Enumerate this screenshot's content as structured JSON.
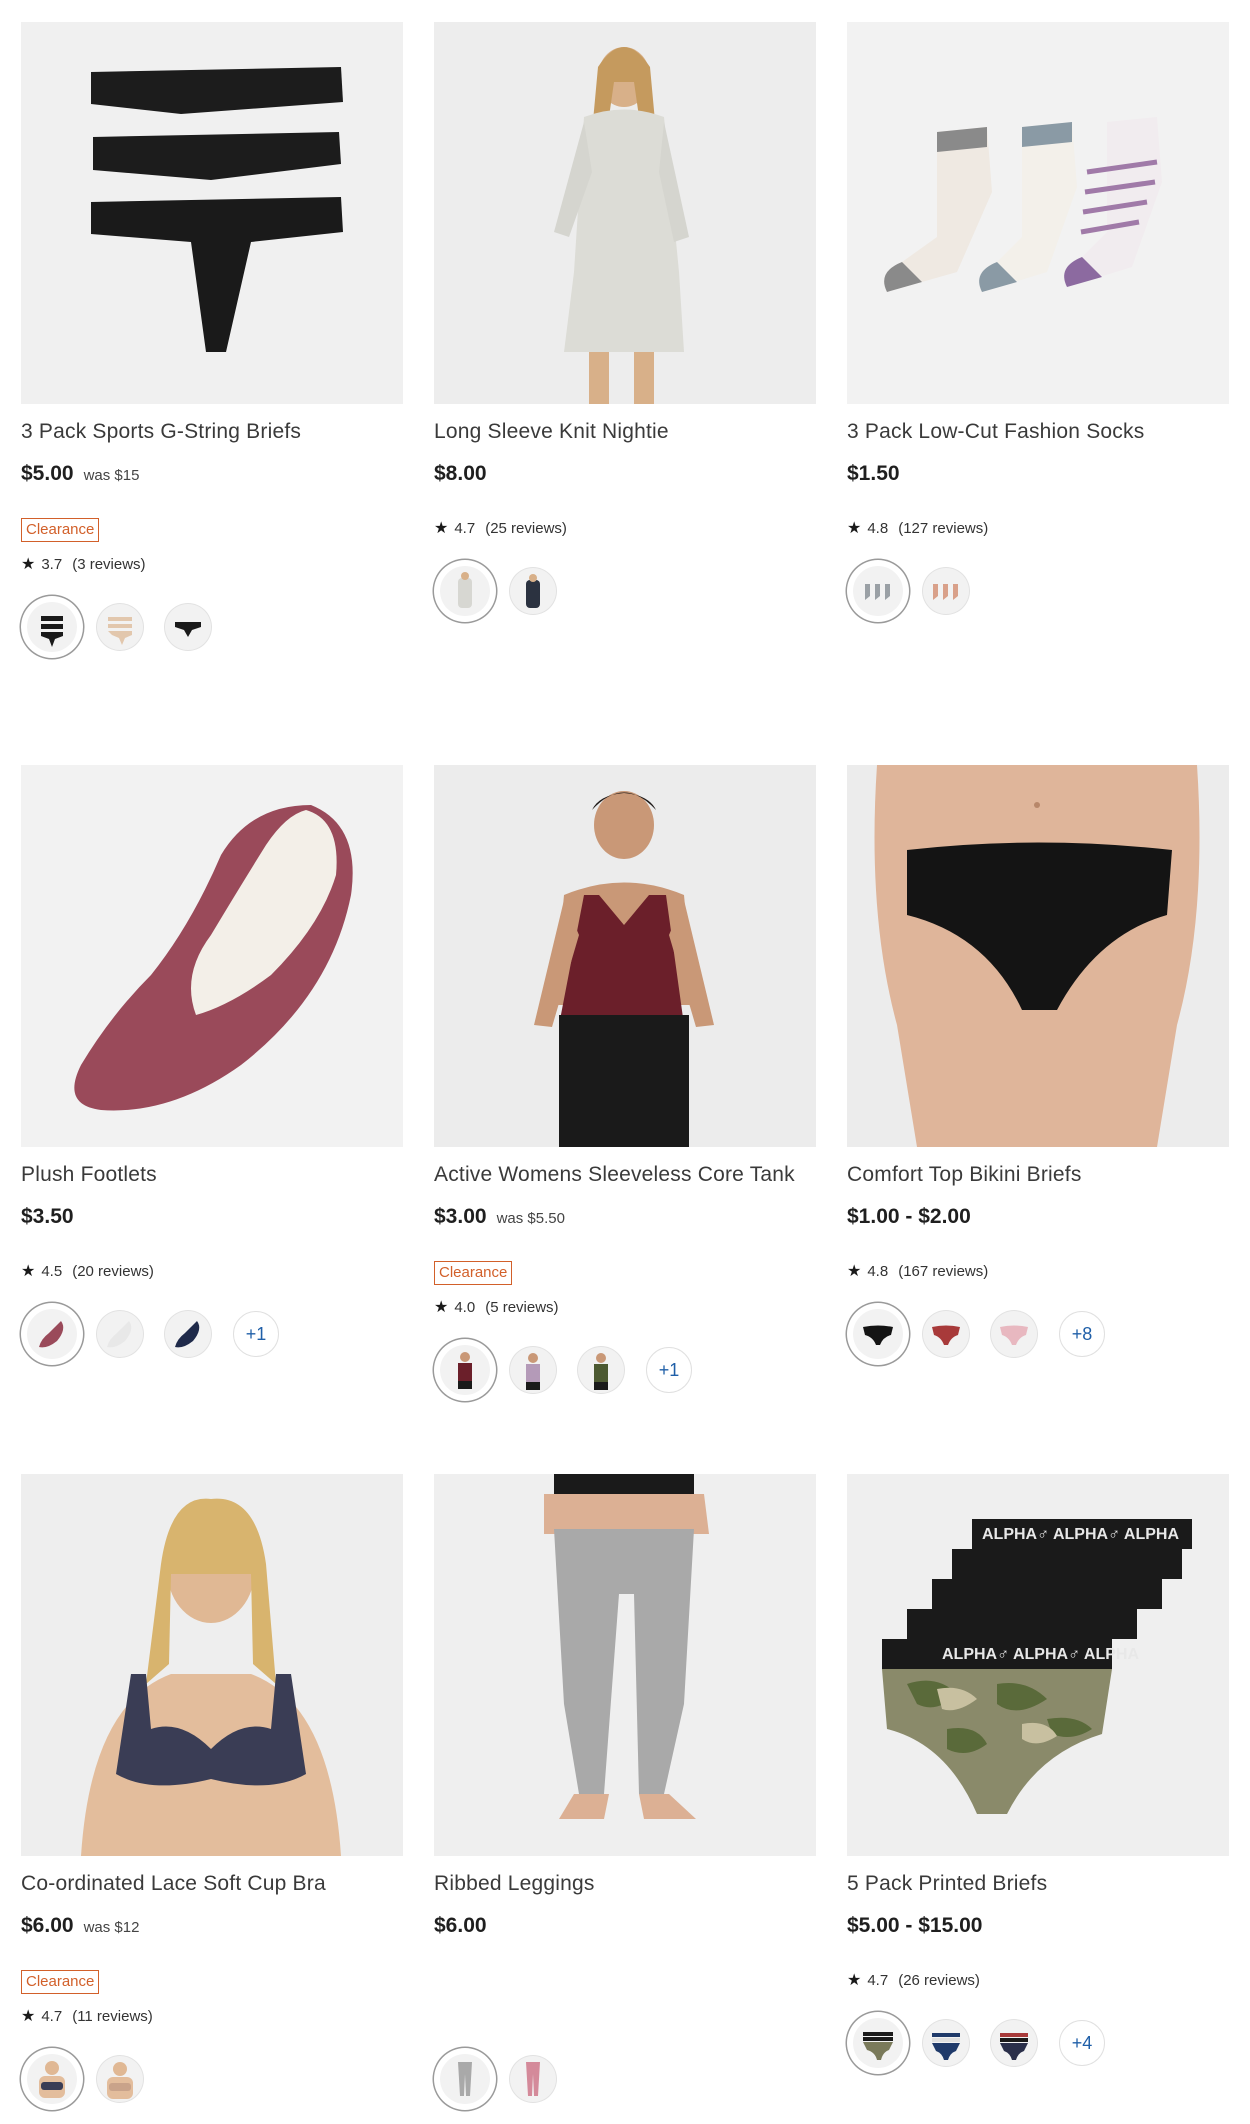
{
  "products": [
    {
      "title": "3 Pack Sports G-String Briefs",
      "price": "$5.00",
      "was": "was $15",
      "badge": "Clearance",
      "rating": "3.7",
      "reviews": "(3 reviews)",
      "more": ""
    },
    {
      "title": "Long Sleeve Knit Nightie",
      "price": "$8.00",
      "was": "",
      "badge": "",
      "rating": "4.7",
      "reviews": "(25 reviews)",
      "more": ""
    },
    {
      "title": "3 Pack Low-Cut Fashion Socks",
      "price": "$1.50",
      "was": "",
      "badge": "",
      "rating": "4.8",
      "reviews": "(127 reviews)",
      "more": ""
    },
    {
      "title": "Plush Footlets",
      "price": "$3.50",
      "was": "",
      "badge": "",
      "rating": "4.5",
      "reviews": "(20 reviews)",
      "more": "+1"
    },
    {
      "title": "Active Womens Sleeveless Core Tank",
      "price": "$3.00",
      "was": "was $5.50",
      "badge": "Clearance",
      "rating": "4.0",
      "reviews": "(5 reviews)",
      "more": "+1"
    },
    {
      "title": "Comfort Top Bikini Briefs",
      "price": "$1.00 - $2.00",
      "was": "",
      "badge": "",
      "rating": "4.8",
      "reviews": "(167 reviews)",
      "more": "+8"
    },
    {
      "title": "Co-ordinated Lace Soft Cup Bra",
      "price": "$6.00",
      "was": "was $12",
      "badge": "Clearance",
      "rating": "4.7",
      "reviews": "(11 reviews)",
      "more": ""
    },
    {
      "title": "Ribbed Leggings",
      "price": "$6.00",
      "was": "",
      "badge": "",
      "rating": "",
      "reviews": "",
      "more": ""
    },
    {
      "title": "5 Pack Printed Briefs",
      "price": "$5.00 - $15.00",
      "was": "",
      "badge": "",
      "rating": "4.7",
      "reviews": "(26 reviews)",
      "more": "+4"
    }
  ],
  "images": {
    "p9_brand": "ALPHA♂ ALPHA♂ ALPHA"
  },
  "colors": {
    "clearance": "#d2602a",
    "more_link": "#1f5fa8"
  }
}
